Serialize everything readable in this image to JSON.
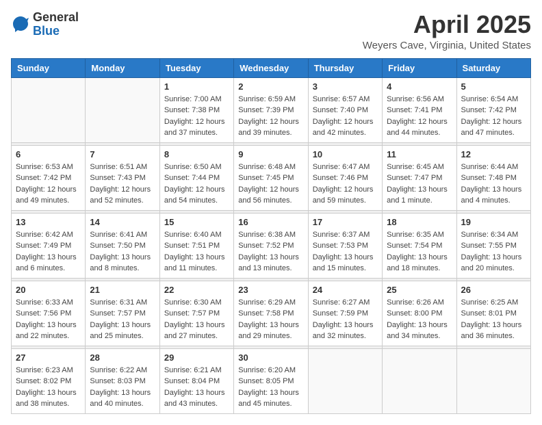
{
  "logo": {
    "general": "General",
    "blue": "Blue"
  },
  "title": "April 2025",
  "subtitle": "Weyers Cave, Virginia, United States",
  "headers": [
    "Sunday",
    "Monday",
    "Tuesday",
    "Wednesday",
    "Thursday",
    "Friday",
    "Saturday"
  ],
  "weeks": [
    [
      {
        "day": "",
        "info": ""
      },
      {
        "day": "",
        "info": ""
      },
      {
        "day": "1",
        "info": "Sunrise: 7:00 AM\nSunset: 7:38 PM\nDaylight: 12 hours\nand 37 minutes."
      },
      {
        "day": "2",
        "info": "Sunrise: 6:59 AM\nSunset: 7:39 PM\nDaylight: 12 hours\nand 39 minutes."
      },
      {
        "day": "3",
        "info": "Sunrise: 6:57 AM\nSunset: 7:40 PM\nDaylight: 12 hours\nand 42 minutes."
      },
      {
        "day": "4",
        "info": "Sunrise: 6:56 AM\nSunset: 7:41 PM\nDaylight: 12 hours\nand 44 minutes."
      },
      {
        "day": "5",
        "info": "Sunrise: 6:54 AM\nSunset: 7:42 PM\nDaylight: 12 hours\nand 47 minutes."
      }
    ],
    [
      {
        "day": "6",
        "info": "Sunrise: 6:53 AM\nSunset: 7:42 PM\nDaylight: 12 hours\nand 49 minutes."
      },
      {
        "day": "7",
        "info": "Sunrise: 6:51 AM\nSunset: 7:43 PM\nDaylight: 12 hours\nand 52 minutes."
      },
      {
        "day": "8",
        "info": "Sunrise: 6:50 AM\nSunset: 7:44 PM\nDaylight: 12 hours\nand 54 minutes."
      },
      {
        "day": "9",
        "info": "Sunrise: 6:48 AM\nSunset: 7:45 PM\nDaylight: 12 hours\nand 56 minutes."
      },
      {
        "day": "10",
        "info": "Sunrise: 6:47 AM\nSunset: 7:46 PM\nDaylight: 12 hours\nand 59 minutes."
      },
      {
        "day": "11",
        "info": "Sunrise: 6:45 AM\nSunset: 7:47 PM\nDaylight: 13 hours\nand 1 minute."
      },
      {
        "day": "12",
        "info": "Sunrise: 6:44 AM\nSunset: 7:48 PM\nDaylight: 13 hours\nand 4 minutes."
      }
    ],
    [
      {
        "day": "13",
        "info": "Sunrise: 6:42 AM\nSunset: 7:49 PM\nDaylight: 13 hours\nand 6 minutes."
      },
      {
        "day": "14",
        "info": "Sunrise: 6:41 AM\nSunset: 7:50 PM\nDaylight: 13 hours\nand 8 minutes."
      },
      {
        "day": "15",
        "info": "Sunrise: 6:40 AM\nSunset: 7:51 PM\nDaylight: 13 hours\nand 11 minutes."
      },
      {
        "day": "16",
        "info": "Sunrise: 6:38 AM\nSunset: 7:52 PM\nDaylight: 13 hours\nand 13 minutes."
      },
      {
        "day": "17",
        "info": "Sunrise: 6:37 AM\nSunset: 7:53 PM\nDaylight: 13 hours\nand 15 minutes."
      },
      {
        "day": "18",
        "info": "Sunrise: 6:35 AM\nSunset: 7:54 PM\nDaylight: 13 hours\nand 18 minutes."
      },
      {
        "day": "19",
        "info": "Sunrise: 6:34 AM\nSunset: 7:55 PM\nDaylight: 13 hours\nand 20 minutes."
      }
    ],
    [
      {
        "day": "20",
        "info": "Sunrise: 6:33 AM\nSunset: 7:56 PM\nDaylight: 13 hours\nand 22 minutes."
      },
      {
        "day": "21",
        "info": "Sunrise: 6:31 AM\nSunset: 7:57 PM\nDaylight: 13 hours\nand 25 minutes."
      },
      {
        "day": "22",
        "info": "Sunrise: 6:30 AM\nSunset: 7:57 PM\nDaylight: 13 hours\nand 27 minutes."
      },
      {
        "day": "23",
        "info": "Sunrise: 6:29 AM\nSunset: 7:58 PM\nDaylight: 13 hours\nand 29 minutes."
      },
      {
        "day": "24",
        "info": "Sunrise: 6:27 AM\nSunset: 7:59 PM\nDaylight: 13 hours\nand 32 minutes."
      },
      {
        "day": "25",
        "info": "Sunrise: 6:26 AM\nSunset: 8:00 PM\nDaylight: 13 hours\nand 34 minutes."
      },
      {
        "day": "26",
        "info": "Sunrise: 6:25 AM\nSunset: 8:01 PM\nDaylight: 13 hours\nand 36 minutes."
      }
    ],
    [
      {
        "day": "27",
        "info": "Sunrise: 6:23 AM\nSunset: 8:02 PM\nDaylight: 13 hours\nand 38 minutes."
      },
      {
        "day": "28",
        "info": "Sunrise: 6:22 AM\nSunset: 8:03 PM\nDaylight: 13 hours\nand 40 minutes."
      },
      {
        "day": "29",
        "info": "Sunrise: 6:21 AM\nSunset: 8:04 PM\nDaylight: 13 hours\nand 43 minutes."
      },
      {
        "day": "30",
        "info": "Sunrise: 6:20 AM\nSunset: 8:05 PM\nDaylight: 13 hours\nand 45 minutes."
      },
      {
        "day": "",
        "info": ""
      },
      {
        "day": "",
        "info": ""
      },
      {
        "day": "",
        "info": ""
      }
    ]
  ]
}
